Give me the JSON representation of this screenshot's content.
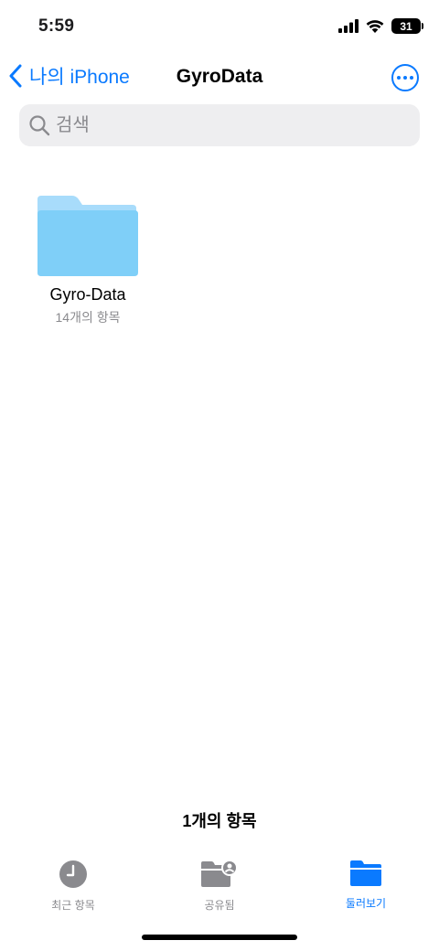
{
  "status_bar": {
    "time": "5:59",
    "battery": "31"
  },
  "nav": {
    "back_label": "나의 iPhone",
    "title": "GyroData",
    "more_icon": "ellipsis-circle-icon"
  },
  "search": {
    "placeholder": "검색"
  },
  "folders": [
    {
      "name": "Gyro-Data",
      "count": "14개의 항목",
      "icon": "folder-icon"
    }
  ],
  "footer": {
    "item_count": "1개의 항목"
  },
  "tabs": [
    {
      "label": "최근 항목",
      "icon": "clock-icon",
      "active": false
    },
    {
      "label": "공유됨",
      "icon": "shared-folder-icon",
      "active": false
    },
    {
      "label": "둘러보기",
      "icon": "folder-icon",
      "active": true
    }
  ],
  "colors": {
    "accent": "#0a7aff",
    "folder_light": "#a8dcfb",
    "folder_main": "#7fcff8",
    "tab_inactive": "#8a8a8e"
  }
}
